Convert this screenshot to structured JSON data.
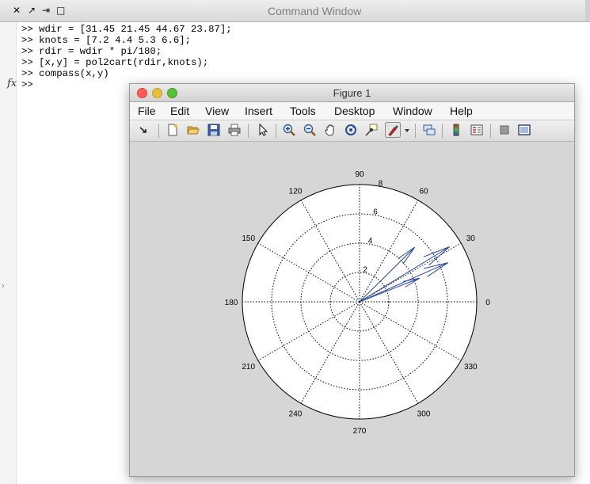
{
  "command_window": {
    "title": "Command Window",
    "controls": [
      "✕",
      "↗",
      "⇥",
      "□"
    ],
    "prompt": ">>",
    "lines": [
      ">> wdir = [31.45 21.45 44.67 23.87];",
      ">> knots = [7.2 4.4 5.3 6.6];",
      ">> rdir = wdir * pi/180;",
      ">> [x,y] = pol2cart(rdir,knots);",
      ">> compass(x,y)",
      ">>"
    ],
    "fx_icon": "fx"
  },
  "figure": {
    "title": "Figure 1",
    "menus": [
      "File",
      "Edit",
      "View",
      "Insert",
      "Tools",
      "Desktop",
      "Window",
      "Help"
    ],
    "toolbar_icons": [
      "dock-arrow-icon",
      "new-figure-icon",
      "open-file-icon",
      "save-icon",
      "print-icon",
      "pointer-icon",
      "zoom-in-icon",
      "zoom-out-icon",
      "pan-icon",
      "rotate-3d-icon",
      "data-cursor-icon",
      "brush-icon",
      "brush-dropdown-icon",
      "link-plot-icon",
      "colorbar-icon",
      "legend-icon",
      "hide-plot-tools-icon",
      "show-plot-tools-icon"
    ],
    "colors": {
      "arrow": "#2b4a9c",
      "background": "#d6d6d6"
    }
  },
  "chart_data": {
    "type": "compass",
    "radial_ticks": [
      "2",
      "4",
      "6",
      "8"
    ],
    "rlim": [
      0,
      8
    ],
    "angle_ticks": [
      "0",
      "30",
      "60",
      "90",
      "120",
      "150",
      "180",
      "210",
      "240",
      "270",
      "300",
      "330"
    ],
    "angles_deg": [
      31.45,
      21.45,
      44.67,
      23.87
    ],
    "magnitudes": [
      7.2,
      4.4,
      5.3,
      6.6
    ],
    "grid": true
  }
}
